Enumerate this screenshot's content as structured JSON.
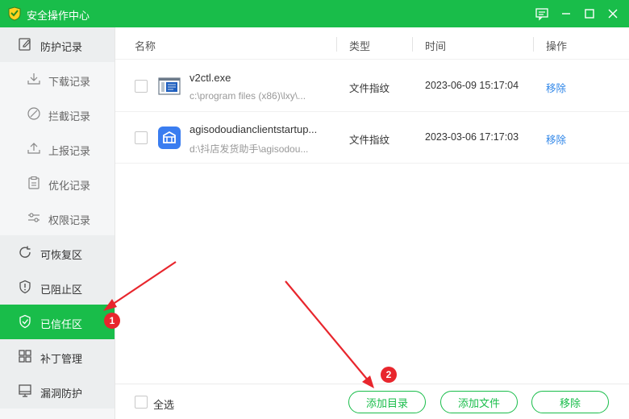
{
  "window": {
    "title": "安全操作中心",
    "icons": [
      "app-logo-icon",
      "feedback-icon",
      "minimize-icon",
      "maximize-icon",
      "close-icon"
    ]
  },
  "sidebar": {
    "items": [
      {
        "label": "防护记录",
        "icon": "edit-record-icon",
        "kind": "group"
      },
      {
        "label": "下载记录",
        "icon": "download-icon",
        "kind": "sub"
      },
      {
        "label": "拦截记录",
        "icon": "block-icon",
        "kind": "sub"
      },
      {
        "label": "上报记录",
        "icon": "upload-icon",
        "kind": "sub"
      },
      {
        "label": "优化记录",
        "icon": "clipboard-icon",
        "kind": "sub"
      },
      {
        "label": "权限记录",
        "icon": "sliders-icon",
        "kind": "sub"
      },
      {
        "label": "可恢复区",
        "icon": "restore-icon",
        "kind": "top"
      },
      {
        "label": "已阻止区",
        "icon": "shield-alert-icon",
        "kind": "top"
      },
      {
        "label": "已信任区",
        "icon": "shield-check-icon",
        "kind": "top",
        "active": true
      },
      {
        "label": "补丁管理",
        "icon": "patch-grid-icon",
        "kind": "top"
      },
      {
        "label": "漏洞防护",
        "icon": "monitor-shield-icon",
        "kind": "top"
      }
    ]
  },
  "table": {
    "columns": {
      "name": "名称",
      "type": "类型",
      "time": "时间",
      "action": "操作"
    },
    "rows": [
      {
        "name": "v2ctl.exe",
        "path": "c:\\program files (x86)\\lxy\\...",
        "type": "文件指纹",
        "time": "2023-06-09 15:17:04",
        "action": "移除",
        "icon": "exe-window-icon"
      },
      {
        "name": "agisodoudianclientstartup...",
        "path": "d:\\抖店发货助手\\agisodou...",
        "type": "文件指纹",
        "time": "2023-03-06 17:17:03",
        "action": "移除",
        "icon": "blue-app-icon"
      }
    ]
  },
  "footer": {
    "select_all": "全选",
    "add_dir": "添加目录",
    "add_file": "添加文件",
    "remove": "移除"
  },
  "annotations": {
    "badge_1": "1",
    "badge_2": "2",
    "color": "#e8262d"
  },
  "colors": {
    "accent": "#19bd4a",
    "link": "#2f86e8",
    "sidebar_bg": "#f5f6f7"
  }
}
